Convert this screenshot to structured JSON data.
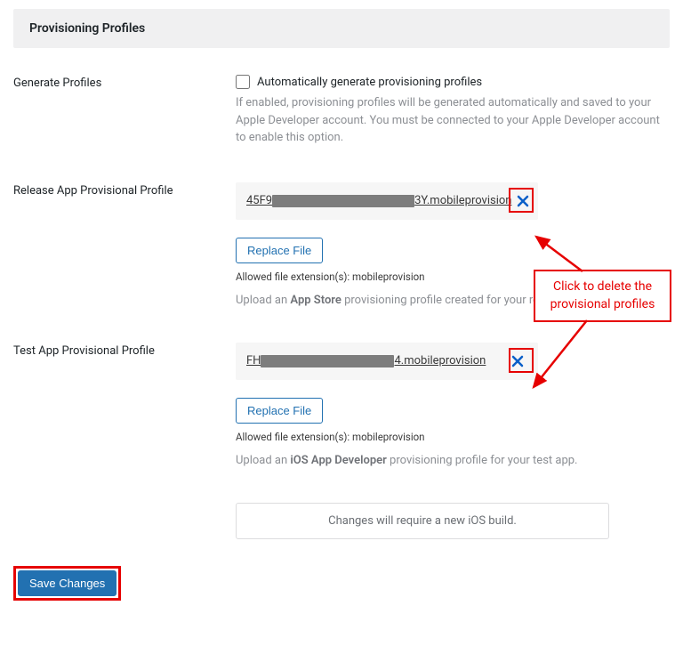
{
  "section": {
    "title": "Provisioning Profiles"
  },
  "generate": {
    "label": "Generate Profiles",
    "checkbox_label": "Automatically generate provisioning profiles",
    "help": "If enabled, provisioning profiles will be generated automatically and saved to your Apple Developer account. You must be connected to your Apple Developer account to enable this option."
  },
  "release": {
    "label": "Release App Provisional Profile",
    "file_prefix": "45F9",
    "file_suffix": "3Y.mobileprovision",
    "replace_btn": "Replace File",
    "allowed": "Allowed file extension(s): mobileprovision",
    "help_pre": "Upload an ",
    "help_bold": "App Store",
    "help_post": " provisioning profile created for your release app."
  },
  "test": {
    "label": "Test App Provisional Profile",
    "file_prefix": "FH",
    "file_suffix": "4.mobileprovision",
    "replace_btn": "Replace File",
    "allowed": "Allowed file extension(s): mobileprovision",
    "help_pre": "Upload an ",
    "help_bold": "iOS App Developer",
    "help_post": " provisioning profile for your test app."
  },
  "notice": "Changes will require a new iOS build.",
  "save_btn": "Save Changes",
  "annotation": {
    "text_line1": "Click to delete the",
    "text_line2": "provisional profiles"
  }
}
